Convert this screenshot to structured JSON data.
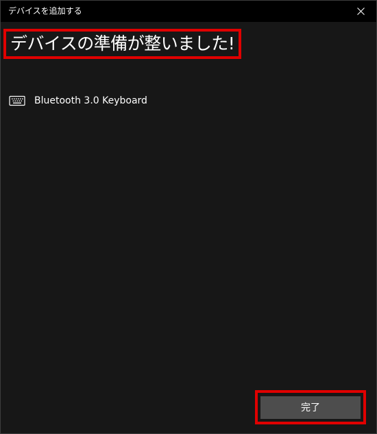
{
  "window": {
    "title": "デバイスを追加する"
  },
  "main": {
    "heading": "デバイスの準備が整いました!",
    "devices": [
      {
        "label": "Bluetooth 3.0 Keyboard",
        "icon": "keyboard-icon"
      }
    ]
  },
  "footer": {
    "done_label": "完了"
  },
  "colors": {
    "highlight": "#e00000",
    "button": "#4d4d4d",
    "background": "#171717"
  }
}
